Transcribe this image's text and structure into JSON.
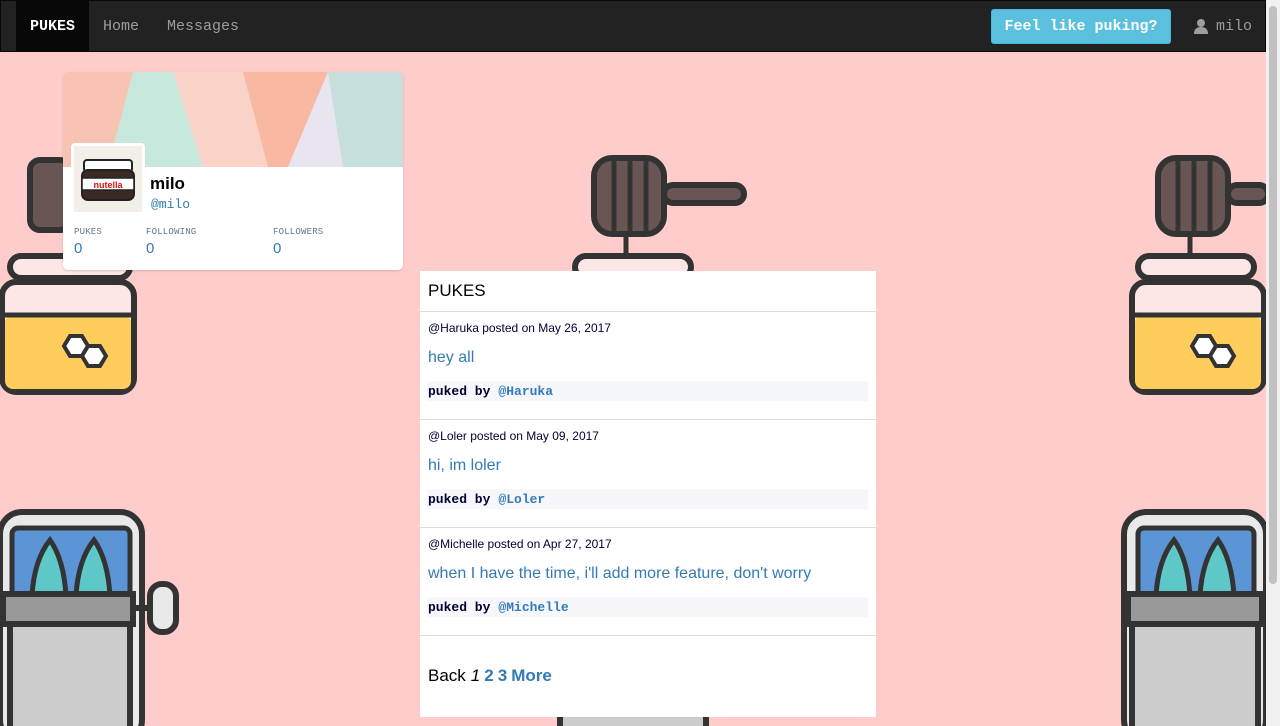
{
  "navbar": {
    "brand": "PUKES",
    "links": [
      "Home",
      "Messages"
    ],
    "cta_label": "Feel like puking?",
    "user_label": "milo",
    "user_icon": "user-icon"
  },
  "profile": {
    "name": "milo",
    "handle": "@milo",
    "stats": [
      {
        "label": "PUKES",
        "value": "0"
      },
      {
        "label": "FOLLOWING",
        "value": "0"
      },
      {
        "label": "FOLLOWERS",
        "value": "0"
      }
    ]
  },
  "feed": {
    "title": "PUKES",
    "posts": [
      {
        "meta": "@Haruka posted on May 26, 2017",
        "text": "hey all",
        "puked_label": "puked by",
        "puked_by": "@Haruka"
      },
      {
        "meta": "@Loler posted on May 09, 2017",
        "text": "hi, im loler",
        "puked_label": "puked by",
        "puked_by": "@Loler"
      },
      {
        "meta": "@Michelle posted on Apr 27, 2017",
        "text": "when I have the time, i'll add more feature, don't worry",
        "puked_label": "puked by",
        "puked_by": "@Michelle"
      }
    ],
    "pagination": {
      "back": "Back",
      "current": "1",
      "pages": [
        "2",
        "3",
        "More"
      ]
    }
  },
  "colors": {
    "background": "#ffcccc",
    "navbar": "#222222",
    "accent": "#5bc0de",
    "link": "#337ab7"
  }
}
